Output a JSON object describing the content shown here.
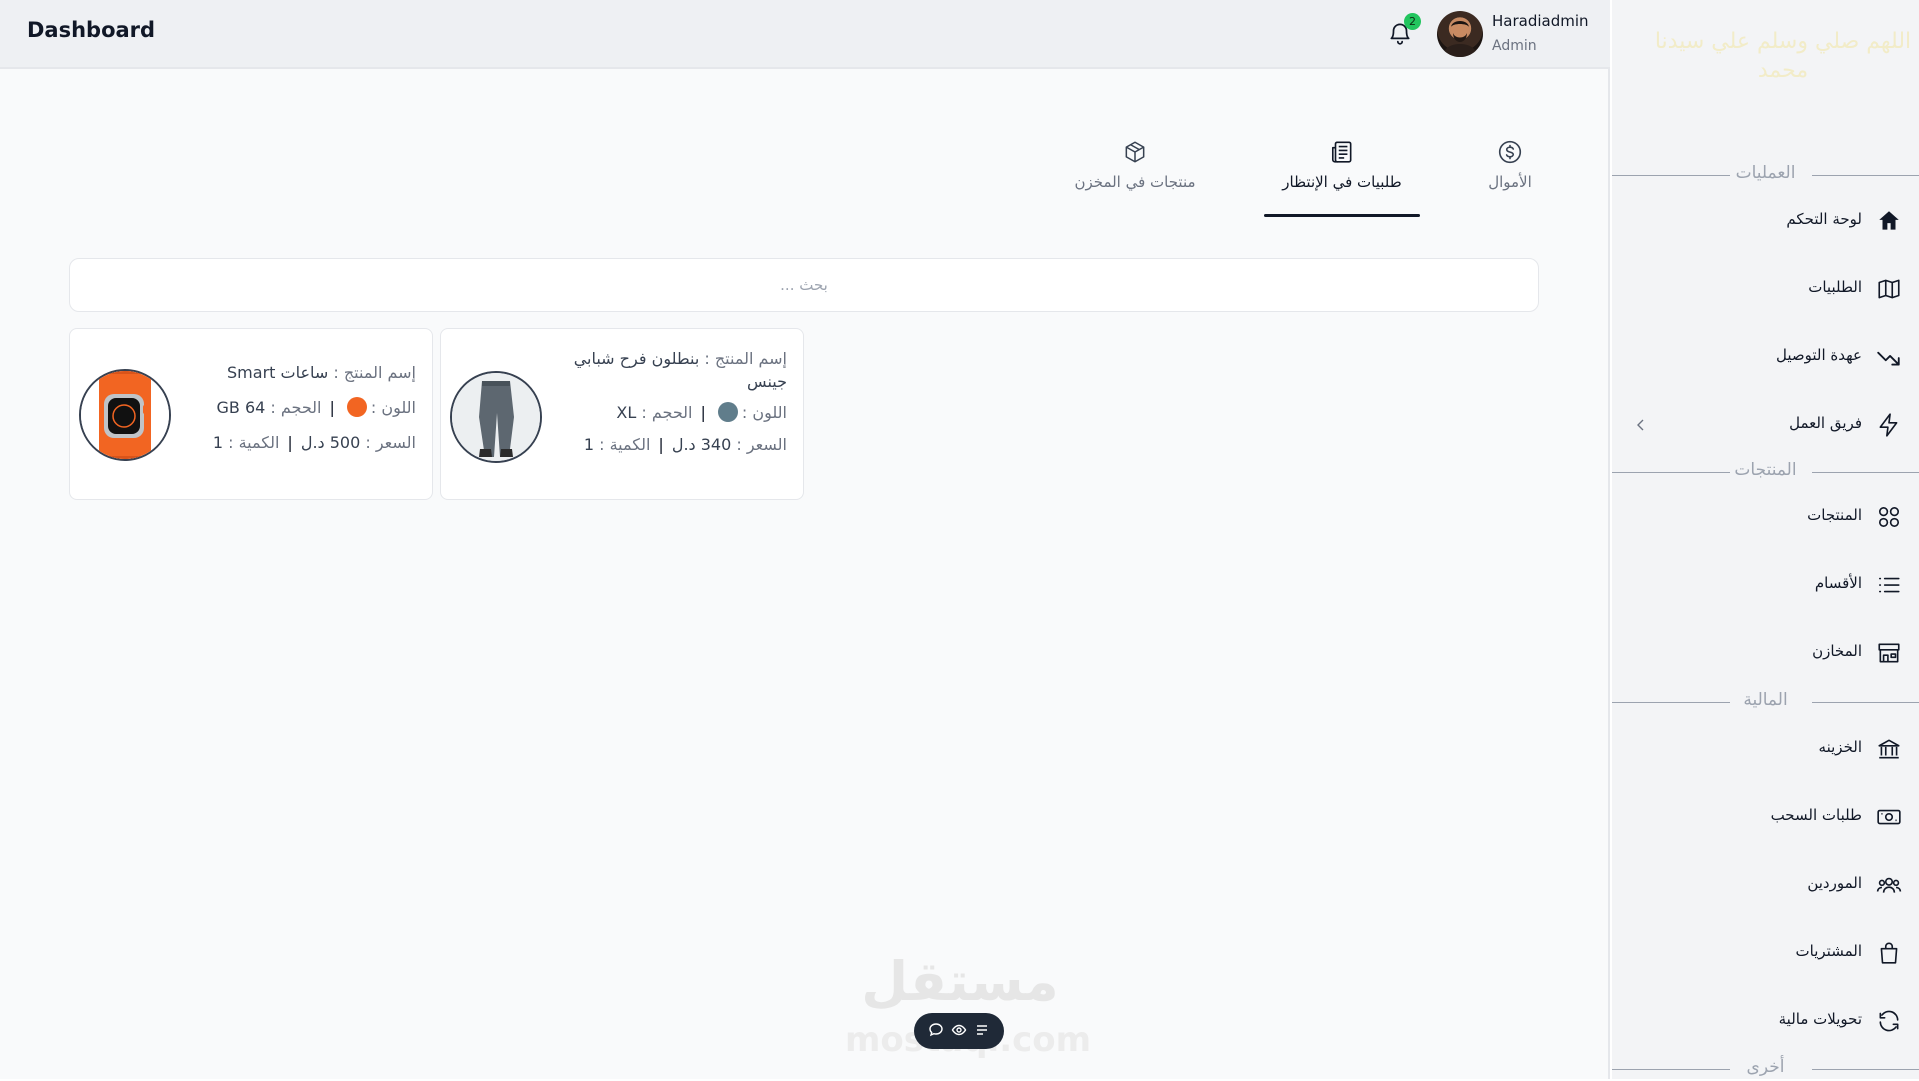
{
  "header": {
    "title": "Dashboard",
    "notification_count": "2",
    "user_name": "Haradiadmin",
    "user_role": "Admin"
  },
  "tabs": [
    {
      "label": "الأموال",
      "icon": "dollar-circle-icon",
      "active": false
    },
    {
      "label": "طلبيات في الإنتظار",
      "icon": "receipt-icon",
      "active": true
    },
    {
      "label": "منتجات في المخزن",
      "icon": "box-icon",
      "active": false
    }
  ],
  "search": {
    "placeholder": "بحث ..."
  },
  "orders": [
    {
      "name_label": "إسم المنتج :",
      "name": "بنطلون فرح شبابي جينس",
      "color_label": "اللون :",
      "color": "#607d8b",
      "size_label": "الحجم :",
      "size": "XL",
      "price_label": "السعر :",
      "price": "340 د.ل",
      "qty_label": "الكمية :",
      "qty": "1"
    },
    {
      "name_label": "إسم المنتج :",
      "name": "ساعات Smart",
      "color_label": "اللون :",
      "color": "#f26522",
      "size_label": "الحجم :",
      "size": "64 GB",
      "price_label": "السعر :",
      "price": "500 د.ل",
      "qty_label": "الكمية :",
      "qty": "1"
    }
  ],
  "sidebar": {
    "quote": "اللهم صلي وسلم علي سيدنا محمد",
    "sections": {
      "operations": "العمليات",
      "products": "المنتجات",
      "finance": "المالية",
      "other": "أخرى"
    },
    "items": [
      {
        "label": "لوحة التحكم",
        "icon": "home-icon"
      },
      {
        "label": "الطلبيات",
        "icon": "map-icon"
      },
      {
        "label": "عهدة التوصيل",
        "icon": "trend-icon"
      },
      {
        "label": "فريق العمل",
        "icon": "bolt-icon"
      },
      {
        "label": "المنتجات",
        "icon": "grid-icon"
      },
      {
        "label": "الأقسام",
        "icon": "list-icon"
      },
      {
        "label": "المخازن",
        "icon": "store-icon"
      },
      {
        "label": "الخزينه",
        "icon": "bank-icon"
      },
      {
        "label": "طلبات السحب",
        "icon": "cash-icon"
      },
      {
        "label": "الموردين",
        "icon": "users-icon"
      },
      {
        "label": "المشتريات",
        "icon": "bag-icon"
      },
      {
        "label": "تحويلات مالية",
        "icon": "refresh-icon"
      }
    ]
  },
  "colors": {
    "accent": "#111827",
    "badge": "#22c55e",
    "sidebar_bg": "#f3f4f6",
    "header_bg": "#eef0f3"
  },
  "watermark": {
    "text_ar": "مستقل",
    "text_en": "mostaql.com"
  }
}
